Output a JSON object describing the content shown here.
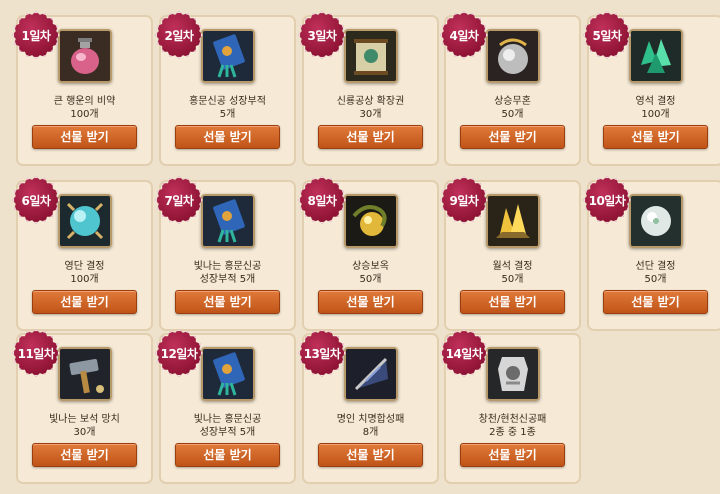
{
  "button_label": "선물 받기",
  "days": [
    {
      "day": "1일차",
      "name": "큰 행운의 비약",
      "qty": "100개",
      "icon": "potion-icon"
    },
    {
      "day": "2일차",
      "name": "홍문신공 성장부적",
      "qty": "5개",
      "icon": "talisman-icon"
    },
    {
      "day": "3일차",
      "name": "신룡공상 확장권",
      "qty": "30개",
      "icon": "scroll-icon"
    },
    {
      "day": "4일차",
      "name": "상승무혼",
      "qty": "50개",
      "icon": "spirit-orb-icon"
    },
    {
      "day": "5일차",
      "name": "영석 결정",
      "qty": "100개",
      "icon": "green-crystal-icon"
    },
    {
      "day": "6일차",
      "name": "영단 결정",
      "qty": "100개",
      "icon": "teal-orb-icon"
    },
    {
      "day": "7일차",
      "name": "빛나는 홍문신공\n성장부적 5개",
      "qty": "",
      "icon": "talisman-icon"
    },
    {
      "day": "8일차",
      "name": "상승보옥",
      "qty": "50개",
      "icon": "gold-dragon-icon"
    },
    {
      "day": "9일차",
      "name": "월석 결정",
      "qty": "50개",
      "icon": "gold-crystal-icon"
    },
    {
      "day": "10일차",
      "name": "선단 결정",
      "qty": "50개",
      "icon": "white-orb-icon"
    },
    {
      "day": "11일차",
      "name": "빛나는 보석 망치",
      "qty": "30개",
      "icon": "hammer-icon"
    },
    {
      "day": "12일차",
      "name": "빛나는 홍문신공\n성장부적 5개",
      "qty": "",
      "icon": "talisman-icon"
    },
    {
      "day": "13일차",
      "name": "명인 치명합성패",
      "qty": "8개",
      "icon": "fan-icon"
    },
    {
      "day": "14일차",
      "name": "창천/현천신공패",
      "qty": "2종 중 1종",
      "icon": "shield-badge-icon"
    }
  ],
  "colors": {
    "button": "#d4672a",
    "badge": "#9a1a3c",
    "card": "#f6ead6"
  }
}
